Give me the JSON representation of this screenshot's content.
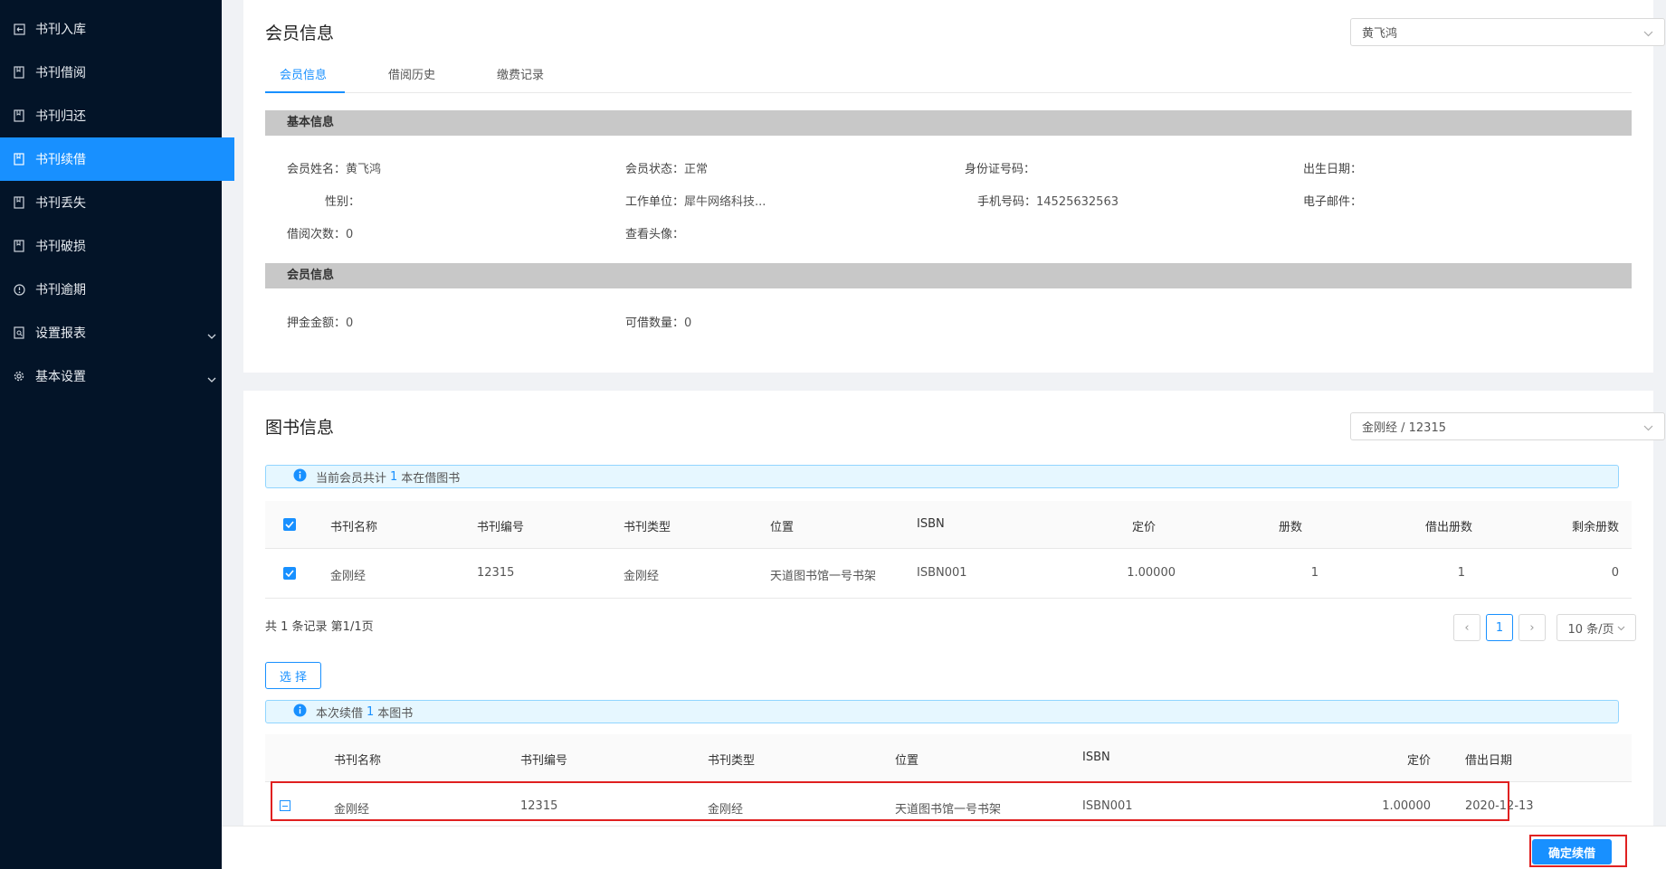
{
  "sidebar": {
    "items": [
      {
        "label": "书刊入库",
        "icon": "import-icon",
        "active": false
      },
      {
        "label": "书刊借阅",
        "icon": "book-icon",
        "active": false
      },
      {
        "label": "书刊归还",
        "icon": "book-icon",
        "active": false
      },
      {
        "label": "书刊续借",
        "icon": "book-icon",
        "active": true
      },
      {
        "label": "书刊丢失",
        "icon": "book-icon",
        "active": false
      },
      {
        "label": "书刊破损",
        "icon": "book-icon",
        "active": false
      },
      {
        "label": "书刊逾期",
        "icon": "alert-circle-icon",
        "active": false
      },
      {
        "label": "设置报表",
        "icon": "report-icon",
        "active": false,
        "expandable": true
      },
      {
        "label": "基本设置",
        "icon": "gear-icon",
        "active": false,
        "expandable": true
      }
    ]
  },
  "member_card": {
    "title": "会员信息",
    "member_select": "黄飞鸿",
    "tabs": [
      "会员信息",
      "借阅历史",
      "缴费记录"
    ],
    "basic_section": {
      "title": "基本信息",
      "fields": {
        "name": {
          "label": "会员姓名：",
          "value": "黄飞鸿"
        },
        "status": {
          "label": "会员状态：",
          "value": "正常"
        },
        "id_no": {
          "label": "身份证号码：",
          "value": ""
        },
        "birthday": {
          "label": "出生日期：",
          "value": ""
        },
        "gender": {
          "label": "性别：",
          "value": ""
        },
        "workplace": {
          "label": "工作单位：",
          "value": "犀牛网络科技..."
        },
        "phone": {
          "label": "手机号码：",
          "value": "14525632563"
        },
        "email": {
          "label": "电子邮件：",
          "value": ""
        },
        "borrow_count": {
          "label": "借阅次数：",
          "value": "0"
        },
        "avatar": {
          "label": "查看头像：",
          "value": ""
        }
      }
    },
    "member_section": {
      "title": "会员信息",
      "fields": {
        "deposit": {
          "label": "押金金额：",
          "value": "0"
        },
        "borrowable": {
          "label": "可借数量：",
          "value": "0"
        }
      }
    }
  },
  "book_card": {
    "title": "图书信息",
    "book_select": "金刚经 / 12315",
    "alert1": {
      "prefix": "当前会员共计",
      "count": "1",
      "suffix": "本在借图书"
    },
    "table1": {
      "headers": [
        "书刊名称",
        "书刊编号",
        "书刊类型",
        "位置",
        "ISBN",
        "定价",
        "册数",
        "借出册数",
        "剩余册数"
      ],
      "rows": [
        [
          "金刚经",
          "12315",
          "金刚经",
          "天道图书馆一号书架",
          "ISBN001",
          "1.00000",
          "1",
          "1",
          "0"
        ]
      ]
    },
    "pagination": {
      "summary": "共 1 条记录 第1/1页",
      "prev": "‹",
      "current_page": "1",
      "next": "›",
      "page_size": "10 条/页"
    },
    "select_button": "选 择",
    "alert2": {
      "prefix": "本次续借",
      "count": "1",
      "suffix": "本图书"
    },
    "table2": {
      "headers": [
        "书刊名称",
        "书刊编号",
        "书刊类型",
        "位置",
        "ISBN",
        "定价",
        "借出日期"
      ],
      "rows": [
        [
          "金刚经",
          "12315",
          "金刚经",
          "天道图书馆一号书架",
          "ISBN001",
          "1.00000",
          "2020-12-13"
        ]
      ]
    }
  },
  "footer": {
    "confirm_button": "确定续借"
  },
  "colors": {
    "sidebar_bg": "#031428",
    "accent": "#1890ff",
    "highlight_border": "#e02020",
    "section_header_bg": "#c8c8c8"
  }
}
